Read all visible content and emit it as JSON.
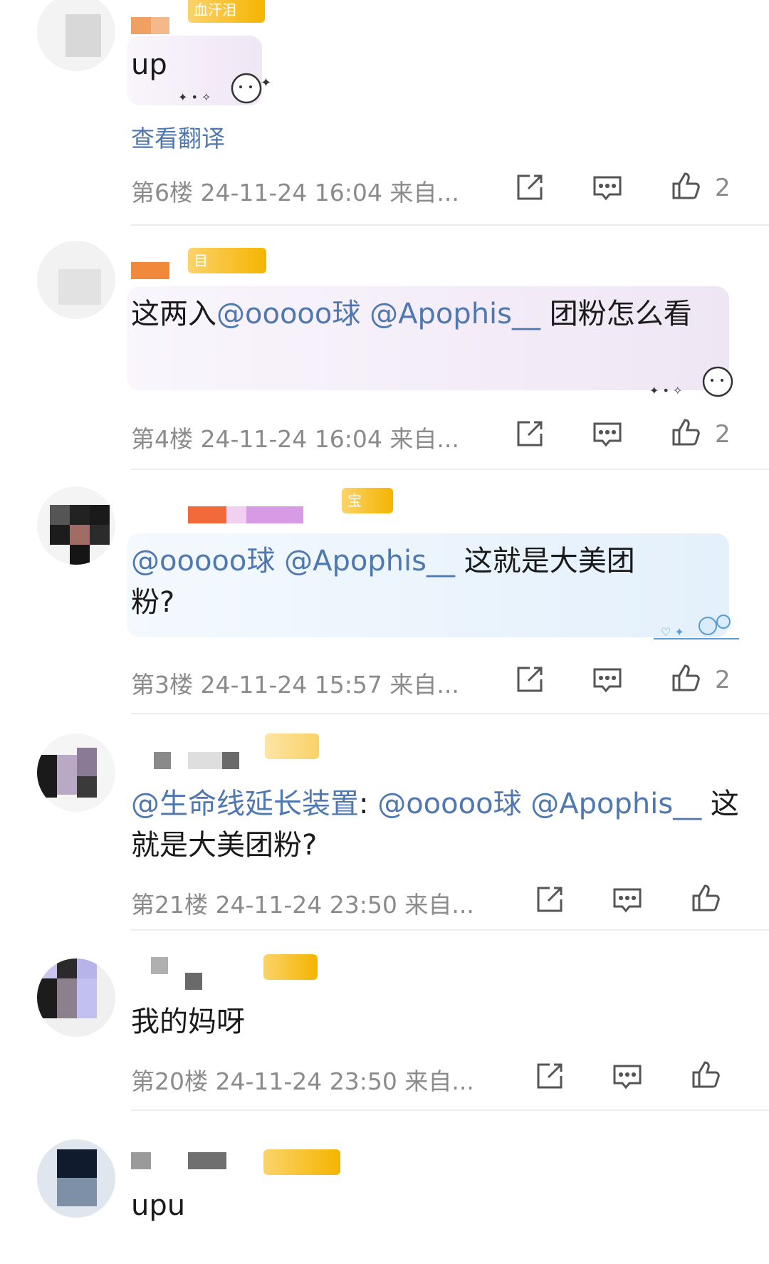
{
  "comments": [
    {
      "text": "up",
      "translate_label": "查看翻译",
      "floor": "第6楼",
      "time": "24-11-24 16:04",
      "source": "来自...",
      "likes": "2",
      "badge_text": "血汗泪"
    },
    {
      "text_parts": [
        "这两入",
        "@ooooo球 @Apophis__",
        " 团粉怎么看"
      ],
      "floor": "第4楼",
      "time": "24-11-24 16:04",
      "source": "来自...",
      "likes": "2",
      "badge_text": "目"
    },
    {
      "text_parts": [
        "@ooooo球 @Apophis__",
        " 这就是大美团粉?"
      ],
      "floor": "第3楼",
      "time": "24-11-24 15:57",
      "source": "来自...",
      "likes": "2",
      "badge_text": "宝"
    },
    {
      "text_parts": [
        "@生命线延长装置",
        ": ",
        "@ooooo球 @Apophis__",
        " 这就是大美团粉?"
      ],
      "floor": "第21楼",
      "time": "24-11-24 23:50",
      "source": "来自...",
      "likes": ""
    },
    {
      "text": "我的妈呀",
      "floor": "第20楼",
      "time": "24-11-24 23:50",
      "source": "来自...",
      "likes": ""
    },
    {
      "text": "upu"
    }
  ],
  "colors": {
    "mention": "#4f78b0",
    "meta": "#8b8b8b",
    "badge": "#f5b400"
  },
  "icons": [
    "share-icon",
    "reply-icon",
    "like-icon"
  ]
}
